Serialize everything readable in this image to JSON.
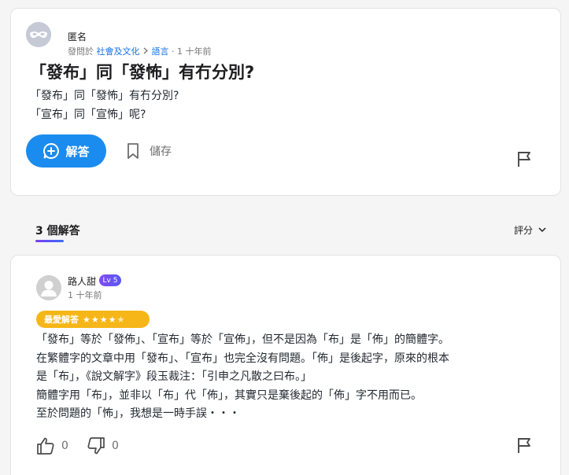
{
  "question": {
    "author": "匿名",
    "posted_in_label": "發問於",
    "category": "社會及文化",
    "subcategory": "語言",
    "time": "1 十年前",
    "title": "「發布」同「發怖」有冇分別?",
    "body_lines": [
      "「發布」同「發怖」有冇分別?",
      "「宣布」同「宣怖」呢?"
    ],
    "answer_button_label": "解答",
    "save_button_label": "儲存"
  },
  "answers_header": {
    "count_label": "3 個解答",
    "sort_label": "評分"
  },
  "answer": {
    "author": "路人甜",
    "level": "Lv 5",
    "time": "1 十年前",
    "best_label": "最愛解答",
    "stars": "★★★★★",
    "rating": 4.5,
    "body_lines": [
      "「發布」等於「發佈」、「宣布」等於「宣佈」，但不是因為「布」是「佈」的簡體字。",
      "在繁體字的文章中用「發布」、「宣布」也完全沒有問題。「佈」是後起字，原來的根本",
      "是「布」，《說文解字》段玉裁注：「引申之凡散之曰布。」",
      "簡體字用「布」，並非以「布」代「佈」，其實只是棄後起的「佈」字不用而已。",
      "至於問題的「怖」，我想是一時手誤・・・"
    ],
    "upvotes": "0",
    "downvotes": "0"
  },
  "colors": {
    "primary_button": "#1a8cf0",
    "link": "#1a73e8",
    "best_badge": "#f6b618",
    "level_badge": "#7f4bf5"
  }
}
